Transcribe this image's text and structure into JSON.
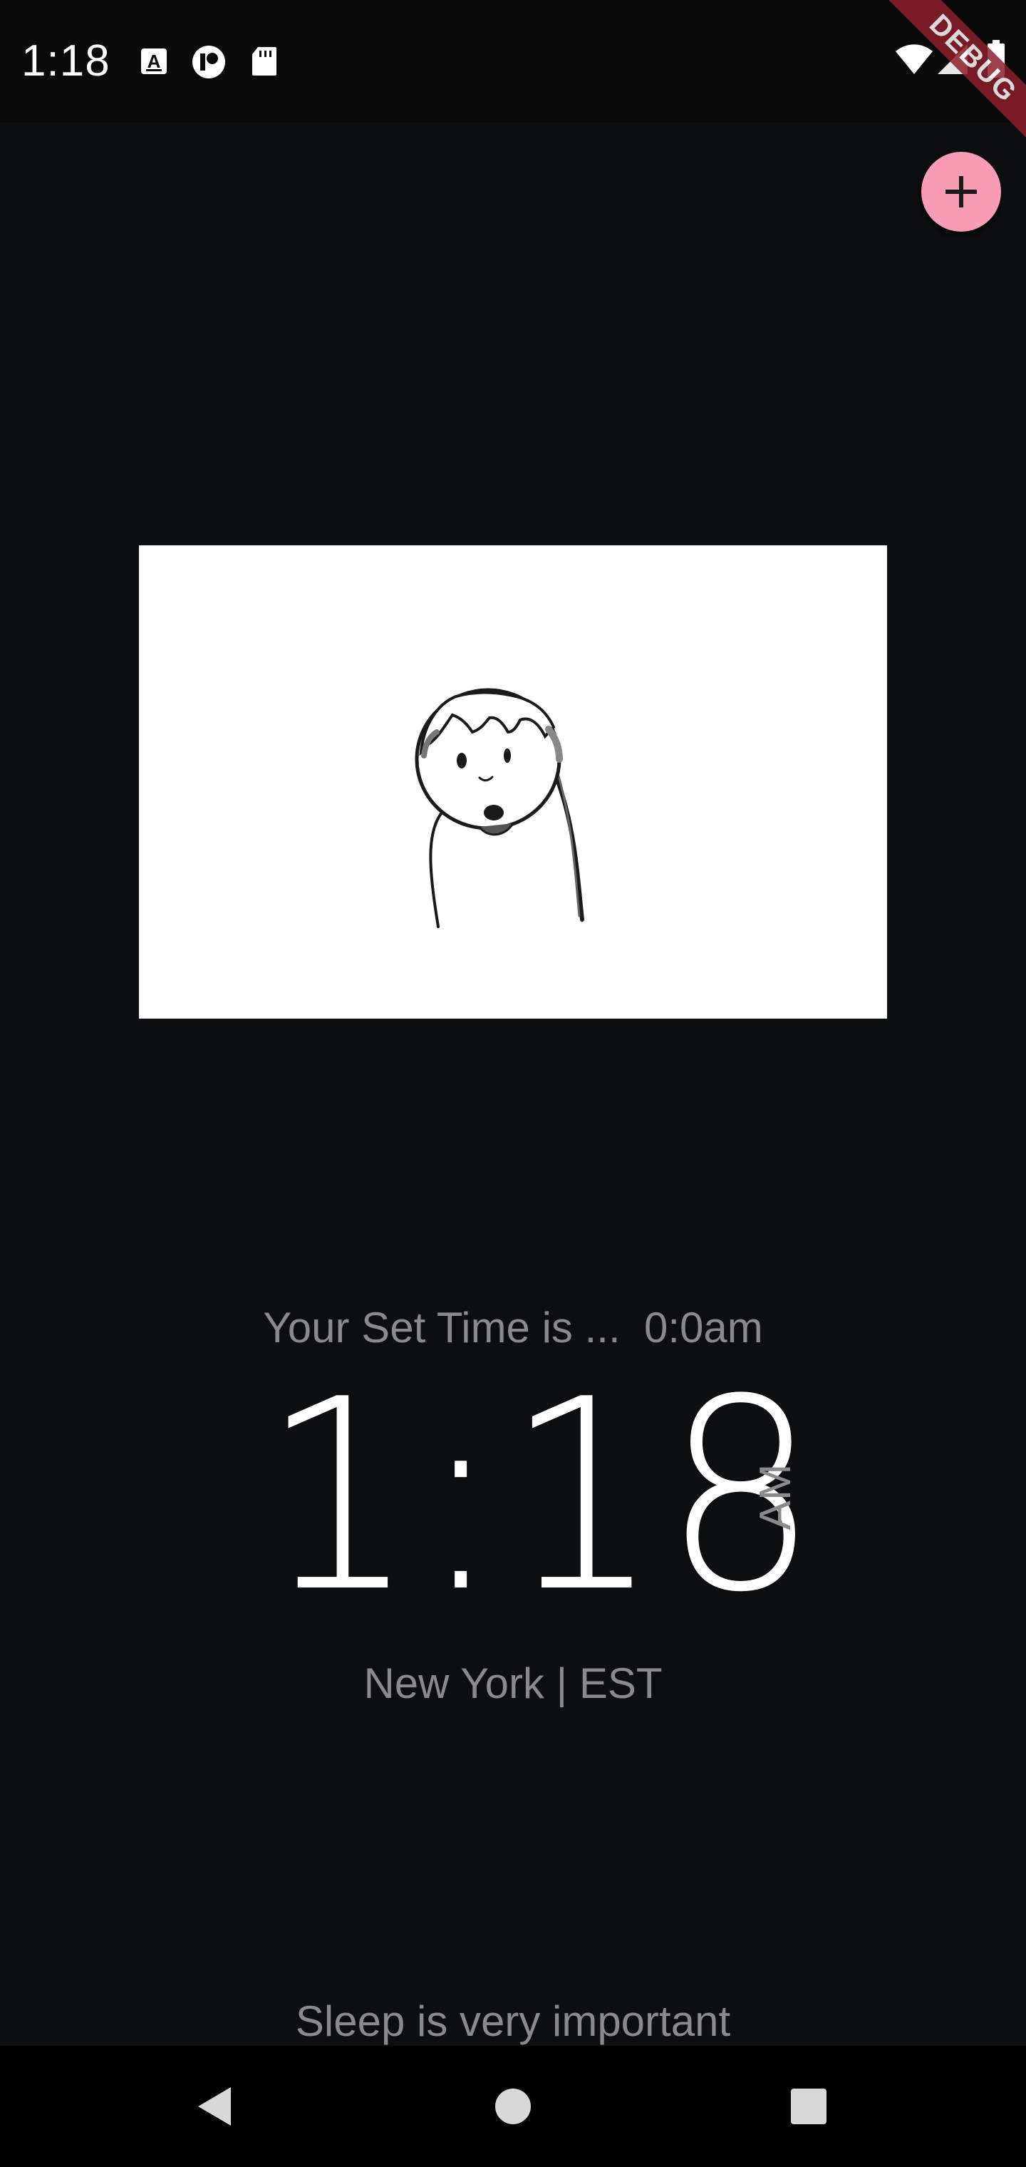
{
  "status_bar": {
    "time": "1:18",
    "icons": [
      "keyboard-a-icon",
      "spotify-like-icon",
      "sd-card-icon"
    ],
    "right_icons": [
      "wifi-icon",
      "signal-icon",
      "battery-icon"
    ]
  },
  "debug_banner": {
    "label": "DEBUG"
  },
  "fab": {
    "icon": "plus-icon",
    "color": "#f99db6"
  },
  "illustration": {
    "description_icon": "cartoon-boy-illustration"
  },
  "alarm": {
    "set_time_text": "Your Set Time is ...  0:0am"
  },
  "clock": {
    "time": "1:18",
    "period": "AM",
    "location": "New York | EST"
  },
  "message": {
    "text": "Sleep is very important"
  },
  "nav": {
    "back": "back-icon",
    "home": "home-icon",
    "recents": "recents-icon"
  },
  "colors": {
    "background": "#0d0e10",
    "accent": "#f99db6",
    "muted_text": "#8a8a8c",
    "primary_text": "#ffffff"
  }
}
